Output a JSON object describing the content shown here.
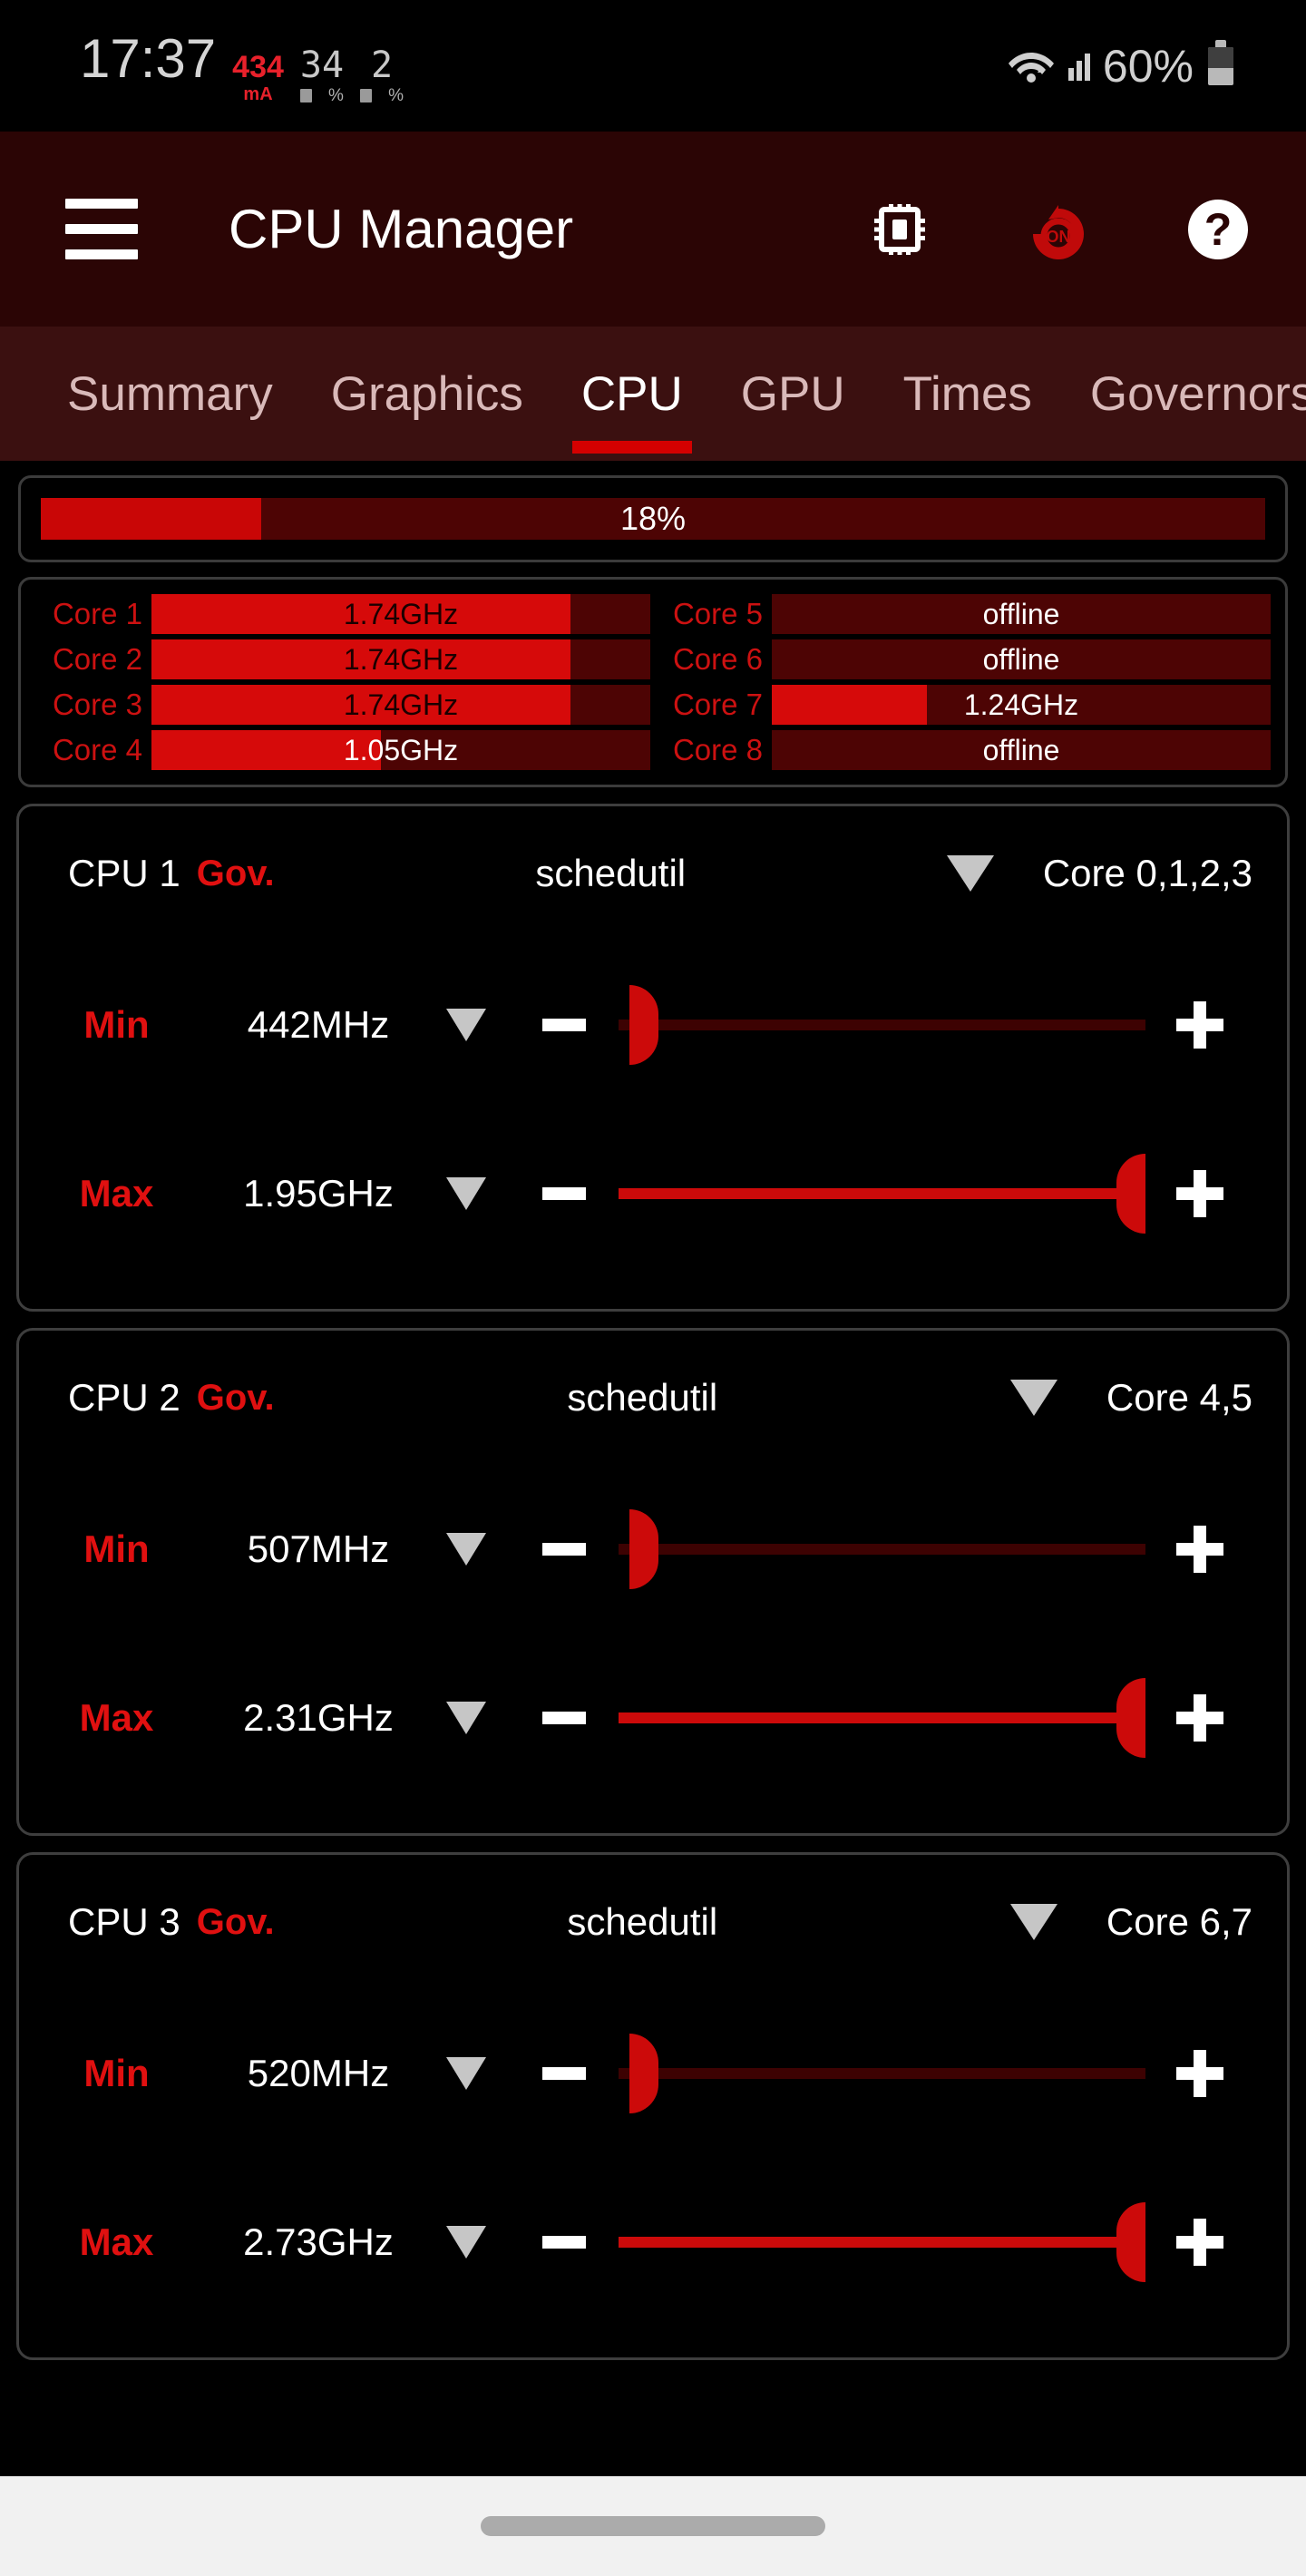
{
  "status_bar": {
    "clock": "17:37",
    "current_draw": "434",
    "current_unit": "mA",
    "cpu_usage": "34",
    "cpu_pct_sign": "%",
    "gpu_usage": "2",
    "gpu_pct_sign": "%",
    "battery_label": "60%",
    "icons": {
      "wifi": "wifi-icon",
      "signal": "cellular-signal-icon",
      "battery": "battery-icon"
    }
  },
  "app_bar": {
    "title": "CPU Manager",
    "menu_icon": "hamburger-menu-icon",
    "cpu_icon": "cpu-chip-icon",
    "reset_icon": "reset-on-icon",
    "help_icon": "help-question-icon",
    "help_glyph": "?",
    "reset_glyph": "ON",
    "background": "#2b0505"
  },
  "tabs": {
    "active_index": 2,
    "items": [
      {
        "label": "Summary"
      },
      {
        "label": "Graphics"
      },
      {
        "label": "CPU"
      },
      {
        "label": "GPU"
      },
      {
        "label": "Times"
      },
      {
        "label": "Governors"
      }
    ],
    "indicator_color": "#d40000"
  },
  "total_usage": {
    "label": "18%",
    "percent": 18,
    "fill_color": "#c90606",
    "track_color": "#4d0404"
  },
  "cores": {
    "left": [
      {
        "label": "Core 1",
        "value": "1.74GHz",
        "percent": 84,
        "offline": false
      },
      {
        "label": "Core 2",
        "value": "1.74GHz",
        "percent": 84,
        "offline": false
      },
      {
        "label": "Core 3",
        "value": "1.74GHz",
        "percent": 84,
        "offline": false
      },
      {
        "label": "Core 4",
        "value": "1.05GHz",
        "percent": 46,
        "offline": false
      }
    ],
    "right": [
      {
        "label": "Core 5",
        "value": "offline",
        "percent": 0,
        "offline": true
      },
      {
        "label": "Core 6",
        "value": "offline",
        "percent": 0,
        "offline": true
      },
      {
        "label": "Core 7",
        "value": "1.24GHz",
        "percent": 31,
        "offline": false
      },
      {
        "label": "Core 8",
        "value": "offline",
        "percent": 0,
        "offline": true
      }
    ]
  },
  "clusters": [
    {
      "name": "CPU 1",
      "gov_label": "Gov.",
      "gov_value": "schedutil",
      "cores": "Core 0,1,2,3",
      "min": {
        "label": "Min",
        "value": "442MHz",
        "percent": 2,
        "minus": "−",
        "plus": "+"
      },
      "max": {
        "label": "Max",
        "value": "1.95GHz",
        "percent": 100,
        "minus": "−",
        "plus": "+"
      }
    },
    {
      "name": "CPU 2",
      "gov_label": "Gov.",
      "gov_value": "schedutil",
      "cores": "Core 4,5",
      "min": {
        "label": "Min",
        "value": "507MHz",
        "percent": 2,
        "minus": "−",
        "plus": "+"
      },
      "max": {
        "label": "Max",
        "value": "2.31GHz",
        "percent": 100,
        "minus": "−",
        "plus": "+"
      }
    },
    {
      "name": "CPU 3",
      "gov_label": "Gov.",
      "gov_value": "schedutil",
      "cores": "Core 6,7",
      "min": {
        "label": "Min",
        "value": "520MHz",
        "percent": 2,
        "minus": "−",
        "plus": "+"
      },
      "max": {
        "label": "Max",
        "value": "2.73GHz",
        "percent": 100,
        "minus": "−",
        "plus": "+"
      }
    }
  ],
  "nav_bar": {
    "pill": "home-gesture-pill"
  }
}
